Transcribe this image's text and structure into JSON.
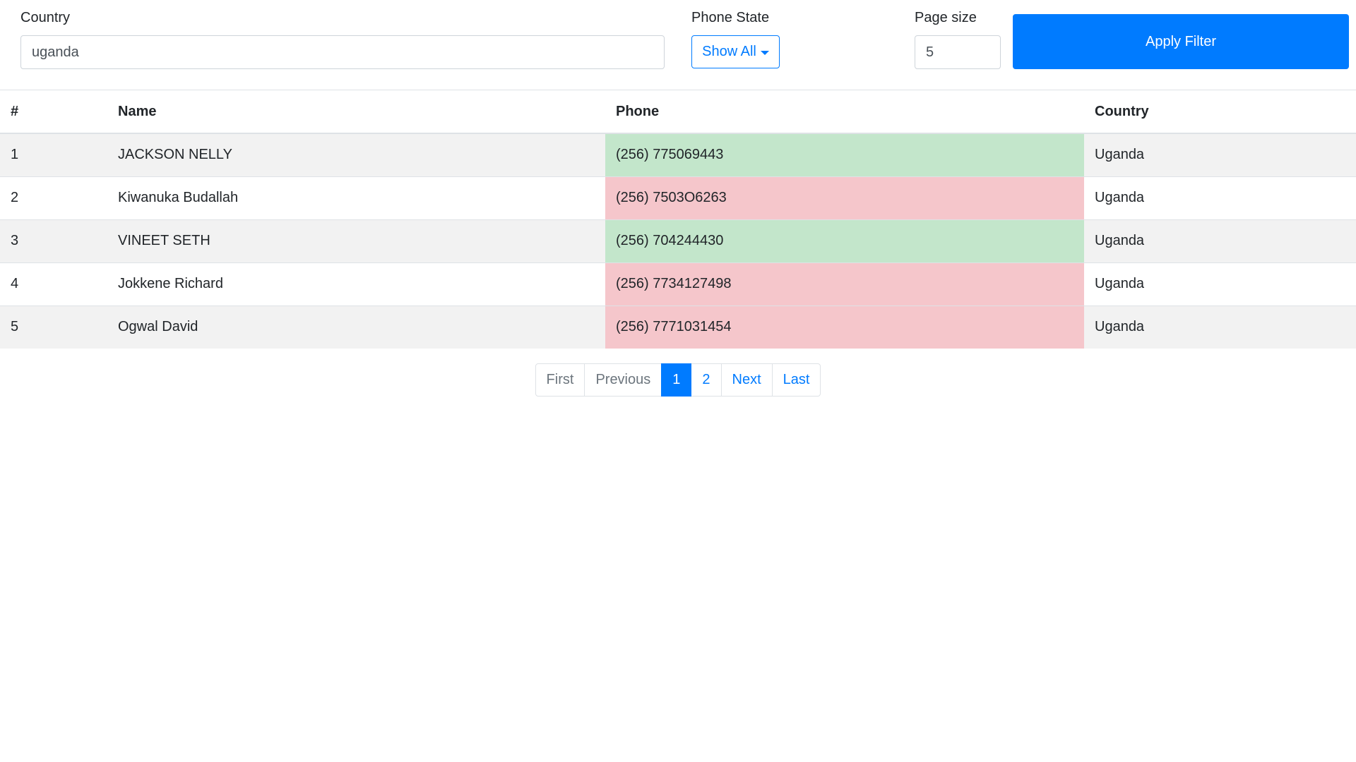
{
  "filters": {
    "country_label": "Country",
    "country_value": "uganda",
    "phone_state_label": "Phone State",
    "phone_state_value": "Show All",
    "page_size_label": "Page size",
    "page_size_value": "5",
    "apply_label": "Apply Filter"
  },
  "table": {
    "headers": {
      "index": "#",
      "name": "Name",
      "phone": "Phone",
      "country": "Country"
    },
    "rows": [
      {
        "index": "1",
        "name": "JACKSON NELLY",
        "phone": "(256) 775069443",
        "country": "Uganda",
        "valid": true
      },
      {
        "index": "2",
        "name": "Kiwanuka Budallah",
        "phone": "(256) 7503O6263",
        "country": "Uganda",
        "valid": false
      },
      {
        "index": "3",
        "name": "VINEET SETH",
        "phone": "(256) 704244430",
        "country": "Uganda",
        "valid": true
      },
      {
        "index": "4",
        "name": "Jokkene Richard",
        "phone": "(256) 7734127498",
        "country": "Uganda",
        "valid": false
      },
      {
        "index": "5",
        "name": "Ogwal David",
        "phone": "(256) 7771031454",
        "country": "Uganda",
        "valid": false
      }
    ]
  },
  "pagination": {
    "first": "First",
    "previous": "Previous",
    "page1": "1",
    "page2": "2",
    "next": "Next",
    "last": "Last"
  },
  "colors": {
    "primary": "#007bff",
    "valid_phone": "#c3e6cb",
    "invalid_phone": "#f5c6cb",
    "striped_row": "#f2f2f2"
  }
}
